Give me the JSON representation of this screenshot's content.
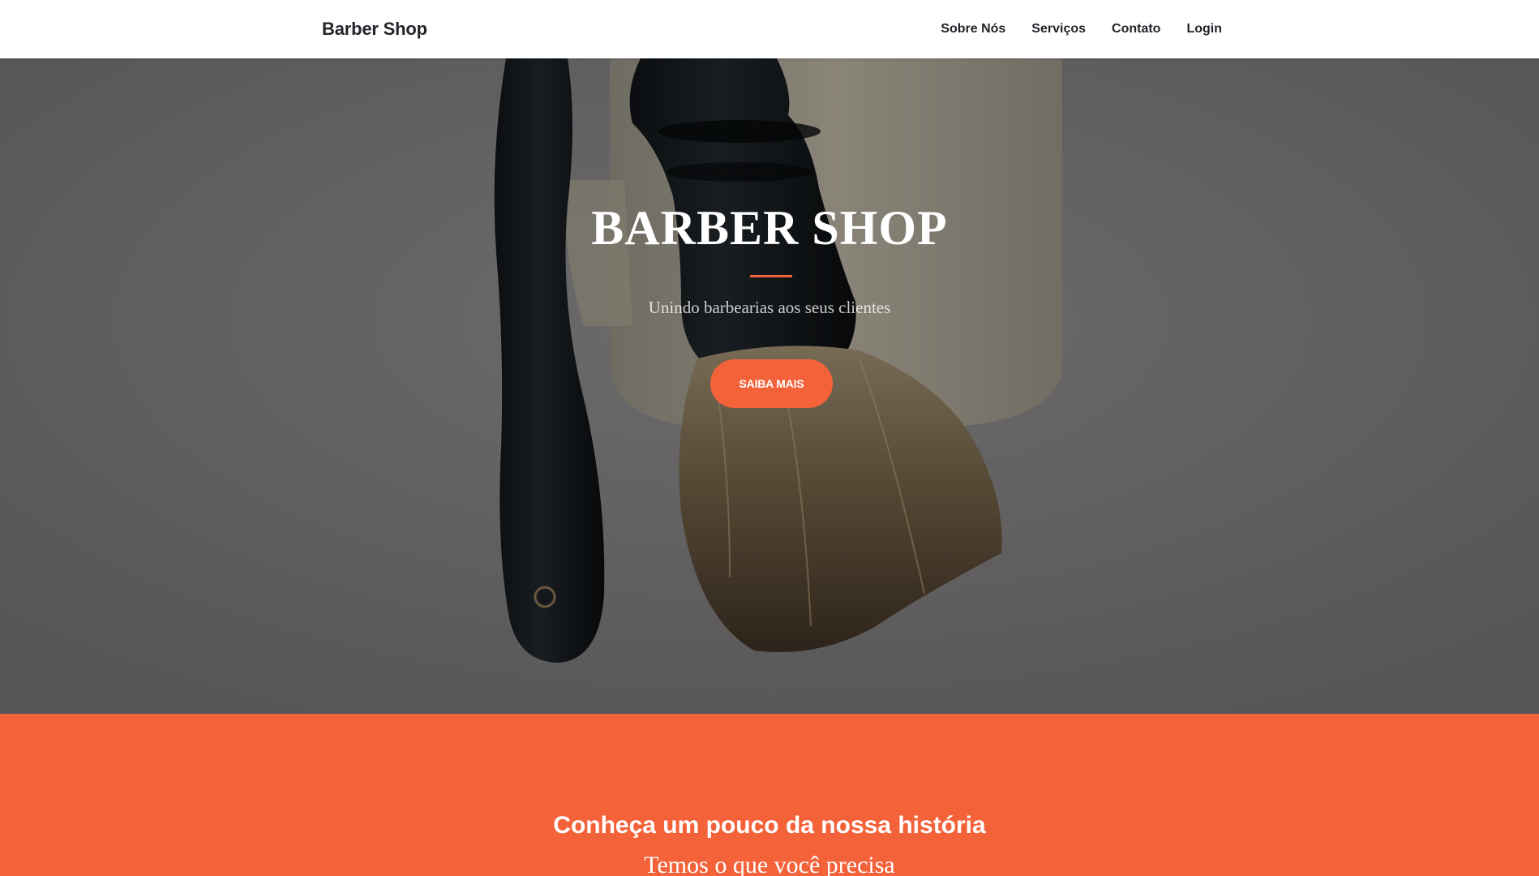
{
  "navbar": {
    "brand": "Barber Shop",
    "links": [
      {
        "label": "Sobre Nós"
      },
      {
        "label": "Serviços"
      },
      {
        "label": "Contato"
      },
      {
        "label": "Login"
      }
    ]
  },
  "hero": {
    "title": "BARBER SHOP",
    "subtitle": "Unindo barbearias aos seus clientes",
    "button_label": "SAIBA MAIS"
  },
  "about": {
    "title": "Conheça um pouco da nossa história",
    "subtitle": "Temos o que você precisa"
  },
  "colors": {
    "accent": "#f4623a",
    "text_dark": "#212529",
    "white": "#ffffff"
  }
}
